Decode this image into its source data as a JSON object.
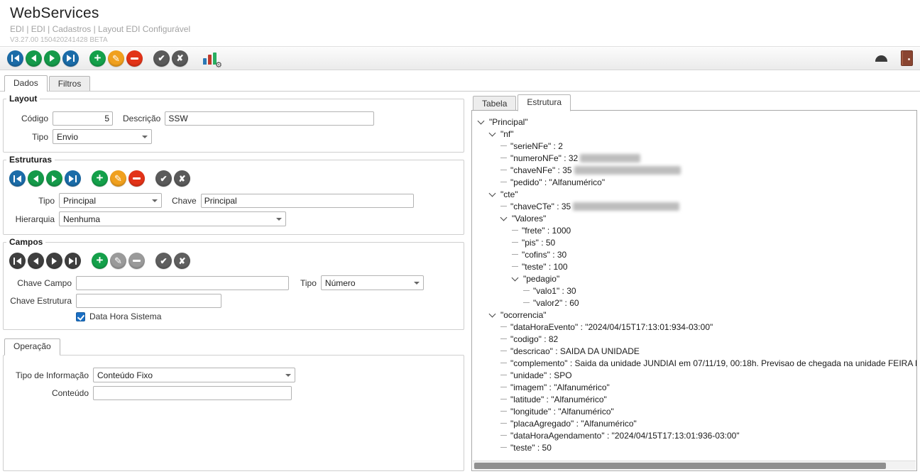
{
  "header": {
    "title": "WebServices",
    "breadcrumb": "EDI | EDI | Cadastros | Layout EDI Configurável",
    "version": "V3.27.00 150420241428 BETA"
  },
  "main_tabs": [
    {
      "label": "Dados",
      "active": true
    },
    {
      "label": "Filtros",
      "active": false
    }
  ],
  "toolbar": {
    "main_icons": [
      {
        "name": "nav-first-button",
        "type": "first",
        "color": "#1b6ca8"
      },
      {
        "name": "nav-prev-button",
        "type": "prev",
        "color": "#159a4a"
      },
      {
        "name": "nav-next-button",
        "type": "next",
        "color": "#159a4a"
      },
      {
        "name": "nav-last-button",
        "type": "last",
        "color": "#1b6ca8"
      },
      {
        "name": "add-button",
        "type": "add",
        "color": "#14a04a",
        "gap_before": true
      },
      {
        "name": "edit-button",
        "type": "edit",
        "color": "#f0a01e"
      },
      {
        "name": "delete-button",
        "type": "delete",
        "color": "#e23318"
      },
      {
        "name": "confirm-button",
        "type": "confirm",
        "color": "#5a5a5a",
        "gap_before": true
      },
      {
        "name": "cancel-button",
        "type": "cancel",
        "color": "#5a5a5a"
      }
    ]
  },
  "layout_section": {
    "legend": "Layout",
    "codigo_label": "Código",
    "codigo_value": "5",
    "descricao_label": "Descrição",
    "descricao_value": "SSW",
    "tipo_label": "Tipo",
    "tipo_value": "Envio"
  },
  "estruturas_section": {
    "legend": "Estruturas",
    "icons": [
      {
        "name": "estruturas-nav-first-button",
        "type": "first",
        "color": "#1b6ca8"
      },
      {
        "name": "estruturas-nav-prev-button",
        "type": "prev",
        "color": "#159a4a"
      },
      {
        "name": "estruturas-nav-next-button",
        "type": "next",
        "color": "#159a4a"
      },
      {
        "name": "estruturas-nav-last-button",
        "type": "last",
        "color": "#1b6ca8"
      },
      {
        "name": "estruturas-add-button",
        "type": "add",
        "color": "#14a04a",
        "gap_before": true
      },
      {
        "name": "estruturas-edit-button",
        "type": "edit",
        "color": "#f0a01e"
      },
      {
        "name": "estruturas-delete-button",
        "type": "delete",
        "color": "#e23318"
      },
      {
        "name": "estruturas-confirm-button",
        "type": "confirm",
        "color": "#5a5a5a",
        "gap_before": true
      },
      {
        "name": "estruturas-cancel-button",
        "type": "cancel",
        "color": "#5a5a5a"
      }
    ],
    "tipo_label": "Tipo",
    "tipo_value": "Principal",
    "chave_label": "Chave",
    "chave_value": "Principal",
    "hierarquia_label": "Hierarquia",
    "hierarquia_value": "Nenhuma"
  },
  "campos_section": {
    "legend": "Campos",
    "icons": [
      {
        "name": "campos-nav-first-button",
        "type": "first",
        "color": "#3f3f3f"
      },
      {
        "name": "campos-nav-prev-button",
        "type": "prev",
        "color": "#3f3f3f"
      },
      {
        "name": "campos-nav-next-button",
        "type": "next",
        "color": "#3f3f3f"
      },
      {
        "name": "campos-nav-last-button",
        "type": "last",
        "color": "#3f3f3f"
      },
      {
        "name": "campos-add-button",
        "type": "add",
        "color": "#14a04a",
        "gap_before": true
      },
      {
        "name": "campos-edit-button",
        "type": "edit",
        "color": "#9a9a9a"
      },
      {
        "name": "campos-delete-button",
        "type": "delete",
        "color": "#9a9a9a"
      },
      {
        "name": "campos-confirm-button",
        "type": "confirm",
        "color": "#5f5f5f",
        "gap_before": true
      },
      {
        "name": "campos-cancel-button",
        "type": "cancel",
        "color": "#5f5f5f"
      }
    ],
    "chave_campo_label": "Chave Campo",
    "chave_campo_value": "",
    "tipo_label": "Tipo",
    "tipo_value": "Número",
    "chave_estrutura_label": "Chave Estrutura",
    "chave_estrutura_value": "",
    "data_hora_label": "Data Hora Sistema",
    "data_hora_checked": true
  },
  "operacao_section": {
    "tab_label": "Operação",
    "tipo_informacao_label": "Tipo de Informação",
    "tipo_informacao_value": "Conteúdo Fixo",
    "conteudo_label": "Conteúdo",
    "conteudo_value": ""
  },
  "right_panel": {
    "tabs": [
      {
        "label": "Tabela",
        "active": false
      },
      {
        "label": "Estrutura",
        "active": true
      }
    ],
    "tree": [
      {
        "label": "\"Principal\"",
        "children": [
          {
            "label": "\"nf\"",
            "children": [
              {
                "text": "\"serieNFe\" : 2"
              },
              {
                "text": "\"numeroNFe\" : 32",
                "blur_width": 85
              },
              {
                "text": "\"chaveNFe\" : 35",
                "blur_width": 150
              },
              {
                "text": "\"pedido\" : \"Alfanumérico\""
              }
            ]
          },
          {
            "label": "\"cte\"",
            "children": [
              {
                "text": "\"chaveCTe\" : 35",
                "blur_width": 150
              },
              {
                "label": "\"Valores\"",
                "children": [
                  {
                    "text": "\"frete\" : 1000"
                  },
                  {
                    "text": "\"pis\" : 50"
                  },
                  {
                    "text": "\"cofins\" : 30"
                  },
                  {
                    "text": "\"teste\" : 100"
                  },
                  {
                    "label": "\"pedagio\"",
                    "children": [
                      {
                        "text": "\"valo1\" : 30"
                      },
                      {
                        "text": "\"valor2\" : 60"
                      }
                    ]
                  }
                ]
              }
            ]
          },
          {
            "label": "\"ocorrencia\"",
            "children": [
              {
                "text": "\"dataHoraEvento\" : \"2024/04/15T17:13:01:934-03:00\""
              },
              {
                "text": "\"codigo\" : 82"
              },
              {
                "text": "\"descricao\" : SAIDA DA UNIDADE"
              },
              {
                "text": "\"complemento\" : Saida da unidade JUNDIAI em 07/11/19, 00:18h. Previsao de chegada na unidade FEIRA DE SANTANA"
              },
              {
                "text": "\"unidade\" : SPO"
              },
              {
                "text": "\"imagem\" : \"Alfanumérico\""
              },
              {
                "text": "\"latitude\" : \"Alfanumérico\""
              },
              {
                "text": "\"longitude\" : \"Alfanumérico\""
              },
              {
                "text": "\"placaAgregado\" : \"Alfanumérico\""
              },
              {
                "text": "\"dataHoraAgendamento\" : \"2024/04/15T17:13:01:936-03:00\""
              },
              {
                "text": "\"teste\" : 50"
              }
            ]
          }
        ]
      }
    ]
  }
}
